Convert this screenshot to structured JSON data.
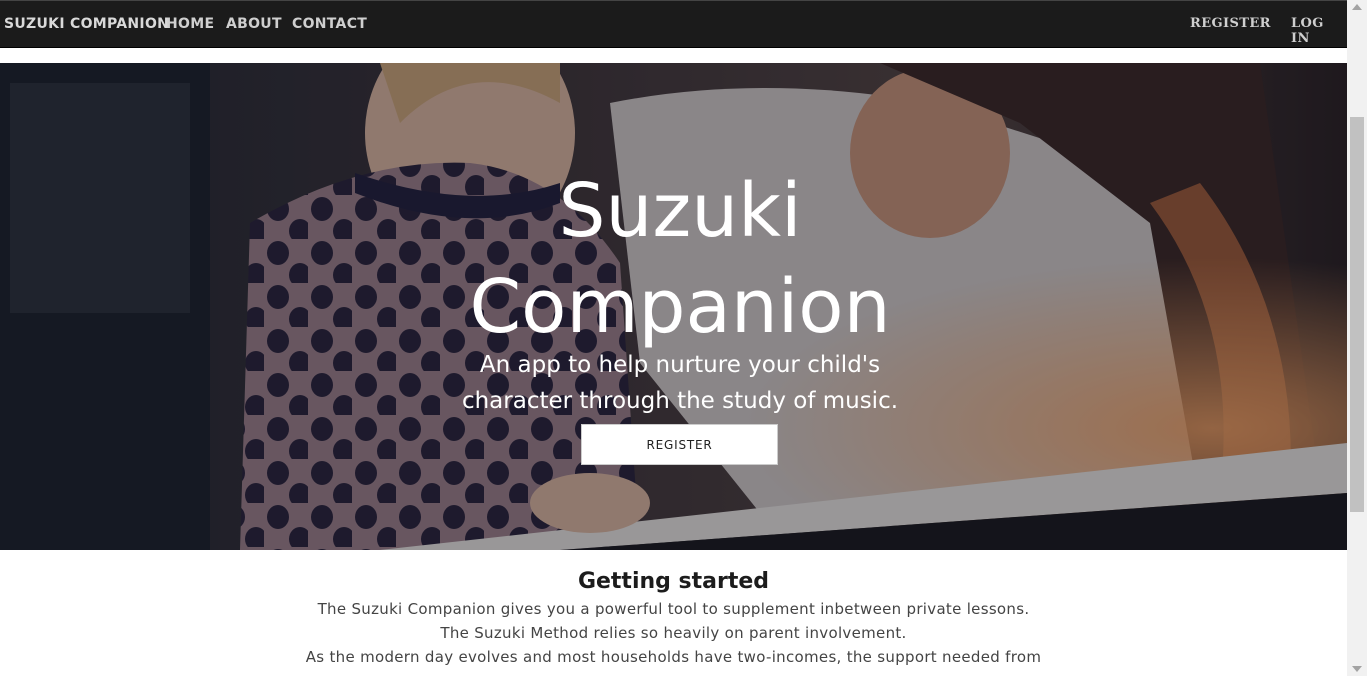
{
  "nav": {
    "brand": "SUZUKI COMPANION",
    "links": [
      "HOME",
      "ABOUT",
      "CONTACT"
    ],
    "register": "REGISTER",
    "login": "LOG IN"
  },
  "hero": {
    "title_line1": "Suzuki",
    "title_line2": "Companion",
    "subtitle_line1": "An app to help nurture your child's",
    "subtitle_line2": "character through the study of music.",
    "button": "REGISTER"
  },
  "section": {
    "title": "Getting started",
    "lines": [
      "The Suzuki Companion gives you a powerful tool to supplement inbetween private lessons.",
      "The Suzuki Method relies so heavily on parent involvement.",
      "As the modern day evolves and most households have two-incomes, the support needed from"
    ]
  }
}
